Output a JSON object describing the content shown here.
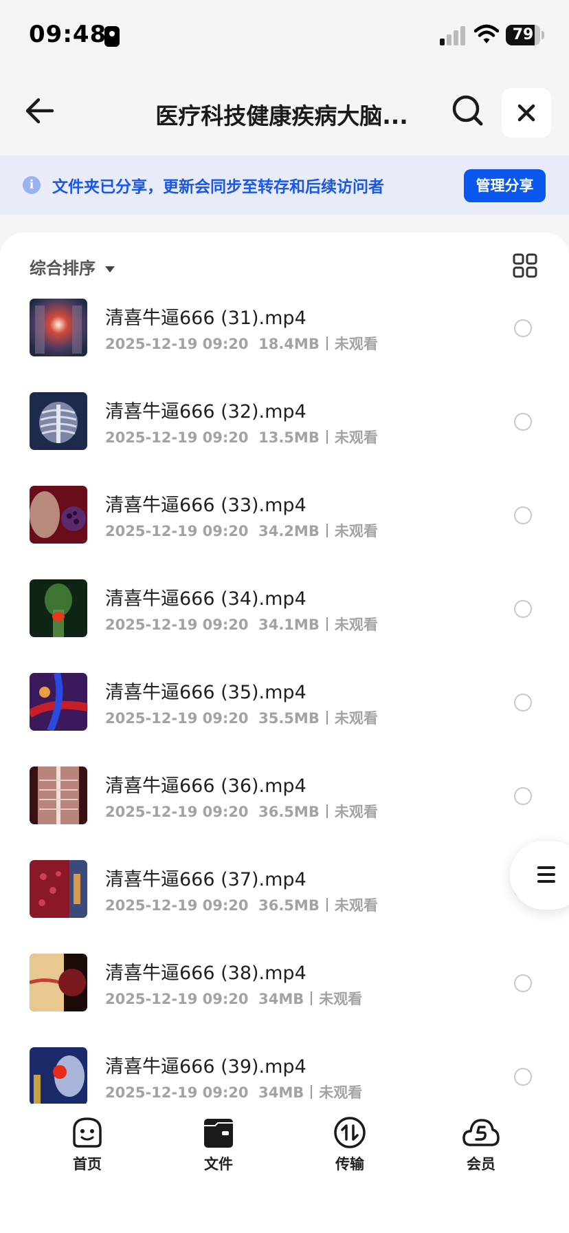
{
  "status_bar": {
    "time": "09:48",
    "battery": "79"
  },
  "nav": {
    "title": "医疗科技健康疾病大脑...",
    "back_icon": "arrow-left-icon",
    "search_icon": "search-icon",
    "close_icon": "close-icon"
  },
  "banner": {
    "text": "文件夹已分享，更新会同步至转存和后续访问者",
    "button_label": "管理分享",
    "accent_color": "#0a57f0"
  },
  "list": {
    "sort_label": "综合排序",
    "view_toggle_icon": "grid-icon",
    "files": [
      {
        "name": "清喜牛逼666 (31).mp4",
        "date": "2025-12-19 09:20",
        "size": "18.4MB",
        "status": "未观看"
      },
      {
        "name": "清喜牛逼666 (32).mp4",
        "date": "2025-12-19 09:20",
        "size": "13.5MB",
        "status": "未观看"
      },
      {
        "name": "清喜牛逼666 (33).mp4",
        "date": "2025-12-19 09:20",
        "size": "34.2MB",
        "status": "未观看"
      },
      {
        "name": "清喜牛逼666 (34).mp4",
        "date": "2025-12-19 09:20",
        "size": "34.1MB",
        "status": "未观看"
      },
      {
        "name": "清喜牛逼666 (35).mp4",
        "date": "2025-12-19 09:20",
        "size": "35.5MB",
        "status": "未观看"
      },
      {
        "name": "清喜牛逼666 (36).mp4",
        "date": "2025-12-19 09:20",
        "size": "36.5MB",
        "status": "未观看"
      },
      {
        "name": "清喜牛逼666 (37).mp4",
        "date": "2025-12-19 09:20",
        "size": "36.5MB",
        "status": "未观看"
      },
      {
        "name": "清喜牛逼666 (38).mp4",
        "date": "2025-12-19 09:20",
        "size": "34MB",
        "status": "未观看"
      },
      {
        "name": "清喜牛逼666 (39).mp4",
        "date": "2025-12-19 09:20",
        "size": "34MB",
        "status": "未观看"
      }
    ]
  },
  "tab_bar": {
    "tabs": [
      {
        "label": "首页",
        "icon": "home-face-icon"
      },
      {
        "label": "文件",
        "icon": "folder-icon"
      },
      {
        "label": "传输",
        "icon": "transfer-icon"
      },
      {
        "label": "会员",
        "icon": "vip-cloud-icon"
      }
    ]
  }
}
